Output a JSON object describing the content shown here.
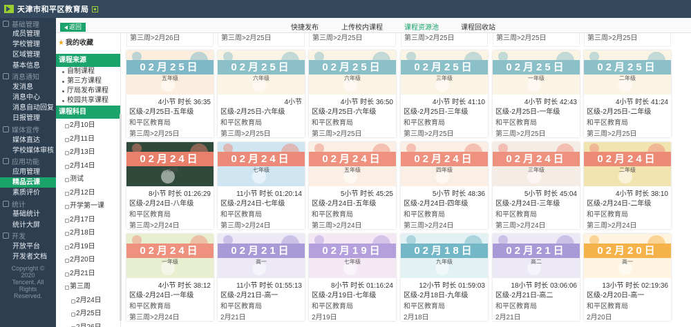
{
  "app": {
    "title": "天津市和平区教育局"
  },
  "sidebar": {
    "sections": [
      {
        "title": "基础管理",
        "items": [
          "成员管理",
          "学校管理",
          "区域管理",
          "基本信息"
        ]
      },
      {
        "title": "消息通知",
        "items": [
          "发消息",
          "消息中心",
          "消息自动回复",
          "日报管理"
        ]
      },
      {
        "title": "媒体宣传",
        "items": [
          "媒体直达",
          "学校媒体审核"
        ]
      },
      {
        "title": "应用功能",
        "items": [
          "应用管理",
          "精品云课",
          "素质评价"
        ]
      },
      {
        "title": "统计",
        "items": [
          "基础统计",
          "统计大屏"
        ]
      },
      {
        "title": "开发",
        "items": [
          "开放平台",
          "开发者文档"
        ]
      }
    ],
    "active": "精品云课",
    "copyright": [
      "Copyright ©",
      "2020",
      "Tencent. All",
      "Rights",
      "Reserved."
    ]
  },
  "tabs": {
    "back_label": "返回",
    "items": [
      "快捷发布",
      "上传校内课程",
      "课程资源池",
      "课程回收站"
    ],
    "active": "课程资源池"
  },
  "left_panel": {
    "favorites": "我的收藏",
    "source_title": "课程来源",
    "sources": [
      "自制课程",
      "第三方课程",
      "厅局发布课程",
      "校园共享课程"
    ],
    "subject_title": "课程科目",
    "days": [
      "2月10日",
      "2月11日",
      "2月13日",
      "2月14日",
      "测试",
      "2月12日",
      "开学第一课",
      "2月17日",
      "2月18日",
      "2月19日",
      "2月20日",
      "2月21日"
    ],
    "week": "第三周",
    "week_days": [
      "2月24日",
      "2月25日",
      "2月26日"
    ]
  },
  "top_strip": [
    "第三周>2月26日",
    "第三周>2月25日",
    "第三周>2月25日",
    "第三周>2月25日",
    "第三周>2月25日",
    "第三周>2月25日"
  ],
  "cards": [
    [
      {
        "date": "02月25日",
        "grade": "五年级",
        "meta": "4小节  时长 36:35",
        "title": "区级-2月25日-五年级",
        "org": "和平区教育局",
        "path": "第三周>2月25日",
        "band": "#7fb8c7",
        "bg": "#fbeede"
      },
      {
        "date": "02月25日",
        "grade": "六年级",
        "meta": "4小节",
        "title": "区级-2月25日-六年级",
        "org": "和平区教育局",
        "path": "第三周>2月25日",
        "band": "#8cc0c8",
        "bg": "#fbf3e4"
      },
      {
        "date": "02月25日",
        "grade": "六年级",
        "meta": "4小节  时长 36:50",
        "title": "区级-2月25日-六年级",
        "org": "和平区教育局",
        "path": "第三周>2月25日",
        "band": "#8cc0c8",
        "bg": "#fbf3e4"
      },
      {
        "date": "02月25日",
        "grade": "三年级",
        "meta": "4小节  时长 41:10",
        "title": "区级-2月25日-三年级",
        "org": "和平区教育局",
        "path": "第三周>2月25日",
        "band": "#8cc0c8",
        "bg": "#fbf3e4"
      },
      {
        "date": "02月25日",
        "grade": "一年级",
        "meta": "4小节  时长 42:43",
        "title": "区级-2月25日-一年级",
        "org": "和平区教育局",
        "path": "第三周>2月25日",
        "band": "#8cc0c8",
        "bg": "#fbf3e4"
      },
      {
        "date": "02月25日",
        "grade": "二年级",
        "meta": "4小节  时长 41:24",
        "title": "区级-2月25日-二年级",
        "org": "和平区教育局",
        "path": "第三周>2月25日",
        "band": "#8cc0c8",
        "bg": "#fbf3e4"
      }
    ],
    [
      {
        "date": "02月24日",
        "grade": "八年级",
        "meta": "8小节  时长 01:26:29",
        "title": "区级-2月24日-八年级",
        "org": "和平区教育局",
        "path": "第三周>2月24日",
        "band": "#e8806c",
        "bg": "#2f4a3a"
      },
      {
        "date": "02月24日",
        "grade": "七年级",
        "meta": "11小节  时长 01:20:14",
        "title": "区级-2月24日-七年级",
        "org": "和平区教育局",
        "path": "第三周>2月24日",
        "band": "#eb8a78",
        "bg": "#cfe6f2"
      },
      {
        "date": "02月24日",
        "grade": "五年级",
        "meta": "5小节  时长 45:25",
        "title": "区级-2月24日-五年级",
        "org": "和平区教育局",
        "path": "第三周>2月24日",
        "band": "#ee917e",
        "bg": "#fbeee4"
      },
      {
        "date": "02月24日",
        "grade": "四年级",
        "meta": "5小节  时长 48:36",
        "title": "区级-2月24日-四年级",
        "org": "和平区教育局",
        "path": "第三周>2月24日",
        "band": "#ee917e",
        "bg": "#fbeee4"
      },
      {
        "date": "02月24日",
        "grade": "三年级",
        "meta": "5小节  时长 45:04",
        "title": "区级-2月24日-三年级",
        "org": "和平区教育局",
        "path": "第三周>2月24日",
        "band": "#ee917e",
        "bg": "#f6ece6"
      },
      {
        "date": "02月24日",
        "grade": "二年级",
        "meta": "4小节  时长 38:10",
        "title": "区级-2月24日-二年级",
        "org": "和平区教育局",
        "path": "第三周>2月24日",
        "band": "#ec8a75",
        "bg": "#f2e4b0"
      }
    ],
    [
      {
        "date": "02月24日",
        "grade": "一年级",
        "meta": "4小节  时长 38:12",
        "title": "区级-2月24日-一年级",
        "org": "和平区教育局",
        "path": "第三周>2月24日",
        "band": "#ee917e",
        "bg": "#e8efd0"
      },
      {
        "date": "02月21日",
        "grade": "高一",
        "meta": "11小节  时长 01:55:13",
        "title": "区级-2月21日-高一",
        "org": "和平区教育局",
        "path": "2月21日",
        "band": "#a89ad6",
        "bg": "#ece8f6"
      },
      {
        "date": "02月19日",
        "grade": "七年级",
        "meta": "8小节  时长 01:16:24",
        "title": "区级-2月19日-七年级",
        "org": "和平区教育局",
        "path": "2月19日",
        "band": "#b4a0dc",
        "bg": "#f3e8f4"
      },
      {
        "date": "02月18日",
        "grade": "九年级",
        "meta": "12小节  时长 01:59:03",
        "title": "区级-2月18日-九年级",
        "org": "和平区教育局",
        "path": "2月18日",
        "band": "#74b8c8",
        "bg": "#e2f1f4"
      },
      {
        "date": "02月21日",
        "grade": "高二",
        "meta": "18小节  时长 03:06:06",
        "title": "区级-2月21日-高二",
        "org": "和平区教育局",
        "path": "2月21日",
        "band": "#a89ad6",
        "bg": "#ece8f6"
      },
      {
        "date": "02月20日",
        "grade": "高一",
        "meta": "13小节  时长 02:19:36",
        "title": "区级-2月20日-高一",
        "org": "和平区教育局",
        "path": "2月20日",
        "band": "#f5b24a",
        "bg": "#fff4e0"
      }
    ]
  ]
}
